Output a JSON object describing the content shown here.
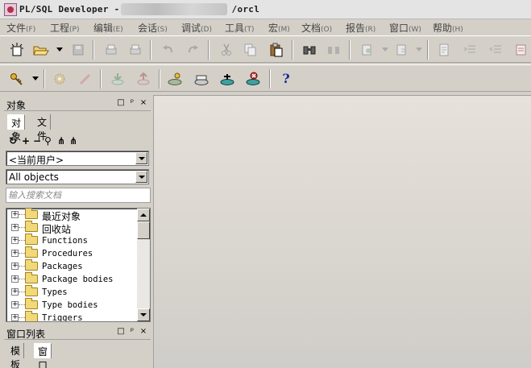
{
  "window": {
    "title_left": "PL/SQL Developer - ",
    "title_right": "/orcl"
  },
  "menu": [
    {
      "label": "文件",
      "acc": "(F)"
    },
    {
      "label": "工程",
      "acc": "(P)"
    },
    {
      "label": "编辑",
      "acc": "(E)"
    },
    {
      "label": "会话",
      "acc": "(S)"
    },
    {
      "label": "调试",
      "acc": "(D)"
    },
    {
      "label": "工具",
      "acc": "(T)"
    },
    {
      "label": "宏",
      "acc": "(M)"
    },
    {
      "label": "文档",
      "acc": "(O)"
    },
    {
      "label": "报告",
      "acc": "(R)"
    },
    {
      "label": "窗口",
      "acc": "(W)"
    },
    {
      "label": "帮助",
      "acc": "(H)"
    }
  ],
  "toolbar2": {
    "help_glyph": "?"
  },
  "object_panel": {
    "title": "对象",
    "buttons": {
      "restore": "□",
      "pin": "ᵖ",
      "close": "×"
    },
    "tabs": [
      "对象",
      "文件"
    ],
    "user_combo": "<当前用户>",
    "filter_combo": "All objects",
    "search_placeholder": "输入搜索文档",
    "tree_items": [
      "最近对象",
      "回收站",
      "Functions",
      "Procedures",
      "Packages",
      "Package bodies",
      "Types",
      "Type bodies",
      "Triggers"
    ]
  },
  "window_panel": {
    "title": "窗口列表",
    "tabs": [
      "模板",
      "窗口列表"
    ]
  }
}
